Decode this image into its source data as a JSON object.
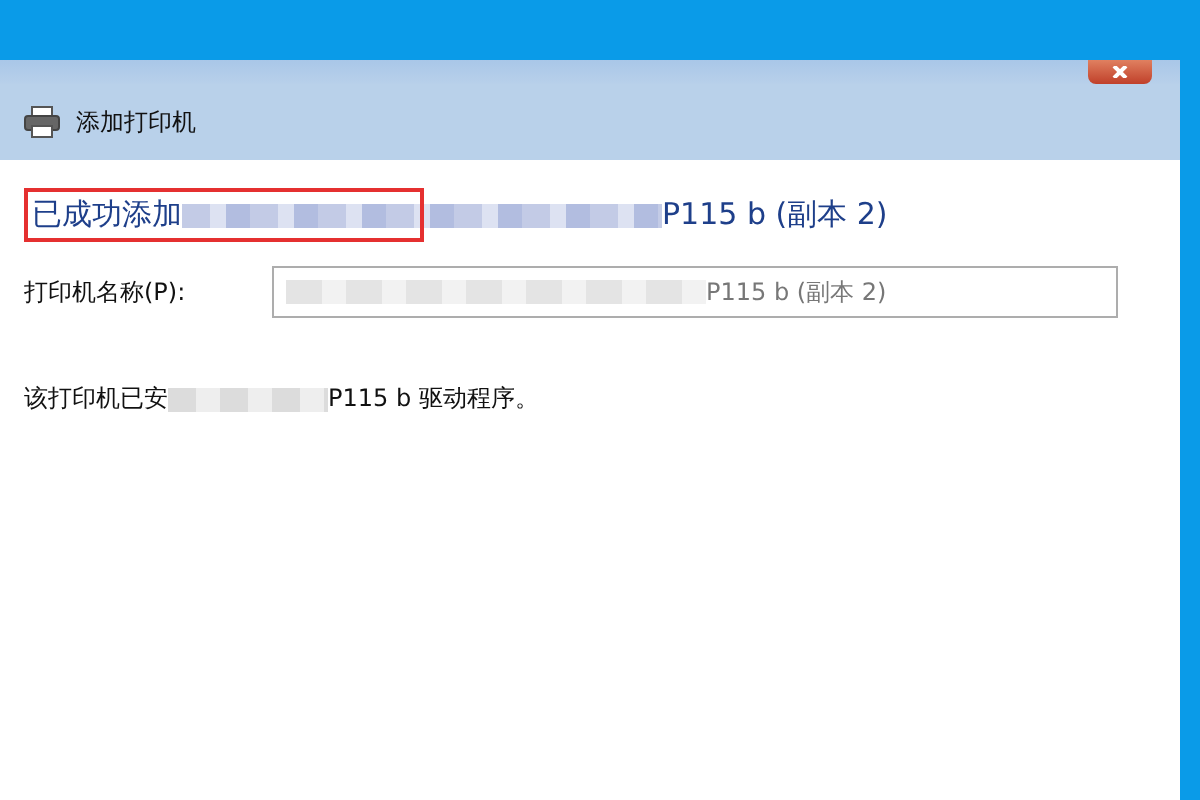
{
  "window": {
    "title": "添加打印机"
  },
  "heading": {
    "prefix": "已成功添加",
    "suffix": "P115 b (副本 2)",
    "highlighted": true
  },
  "name_field": {
    "label": "打印机名称(P):",
    "value": "P115 b (副本 2)"
  },
  "driver_note": {
    "prefix": "该打印机已安",
    "suffix": "P115 b 驱动程序。"
  }
}
